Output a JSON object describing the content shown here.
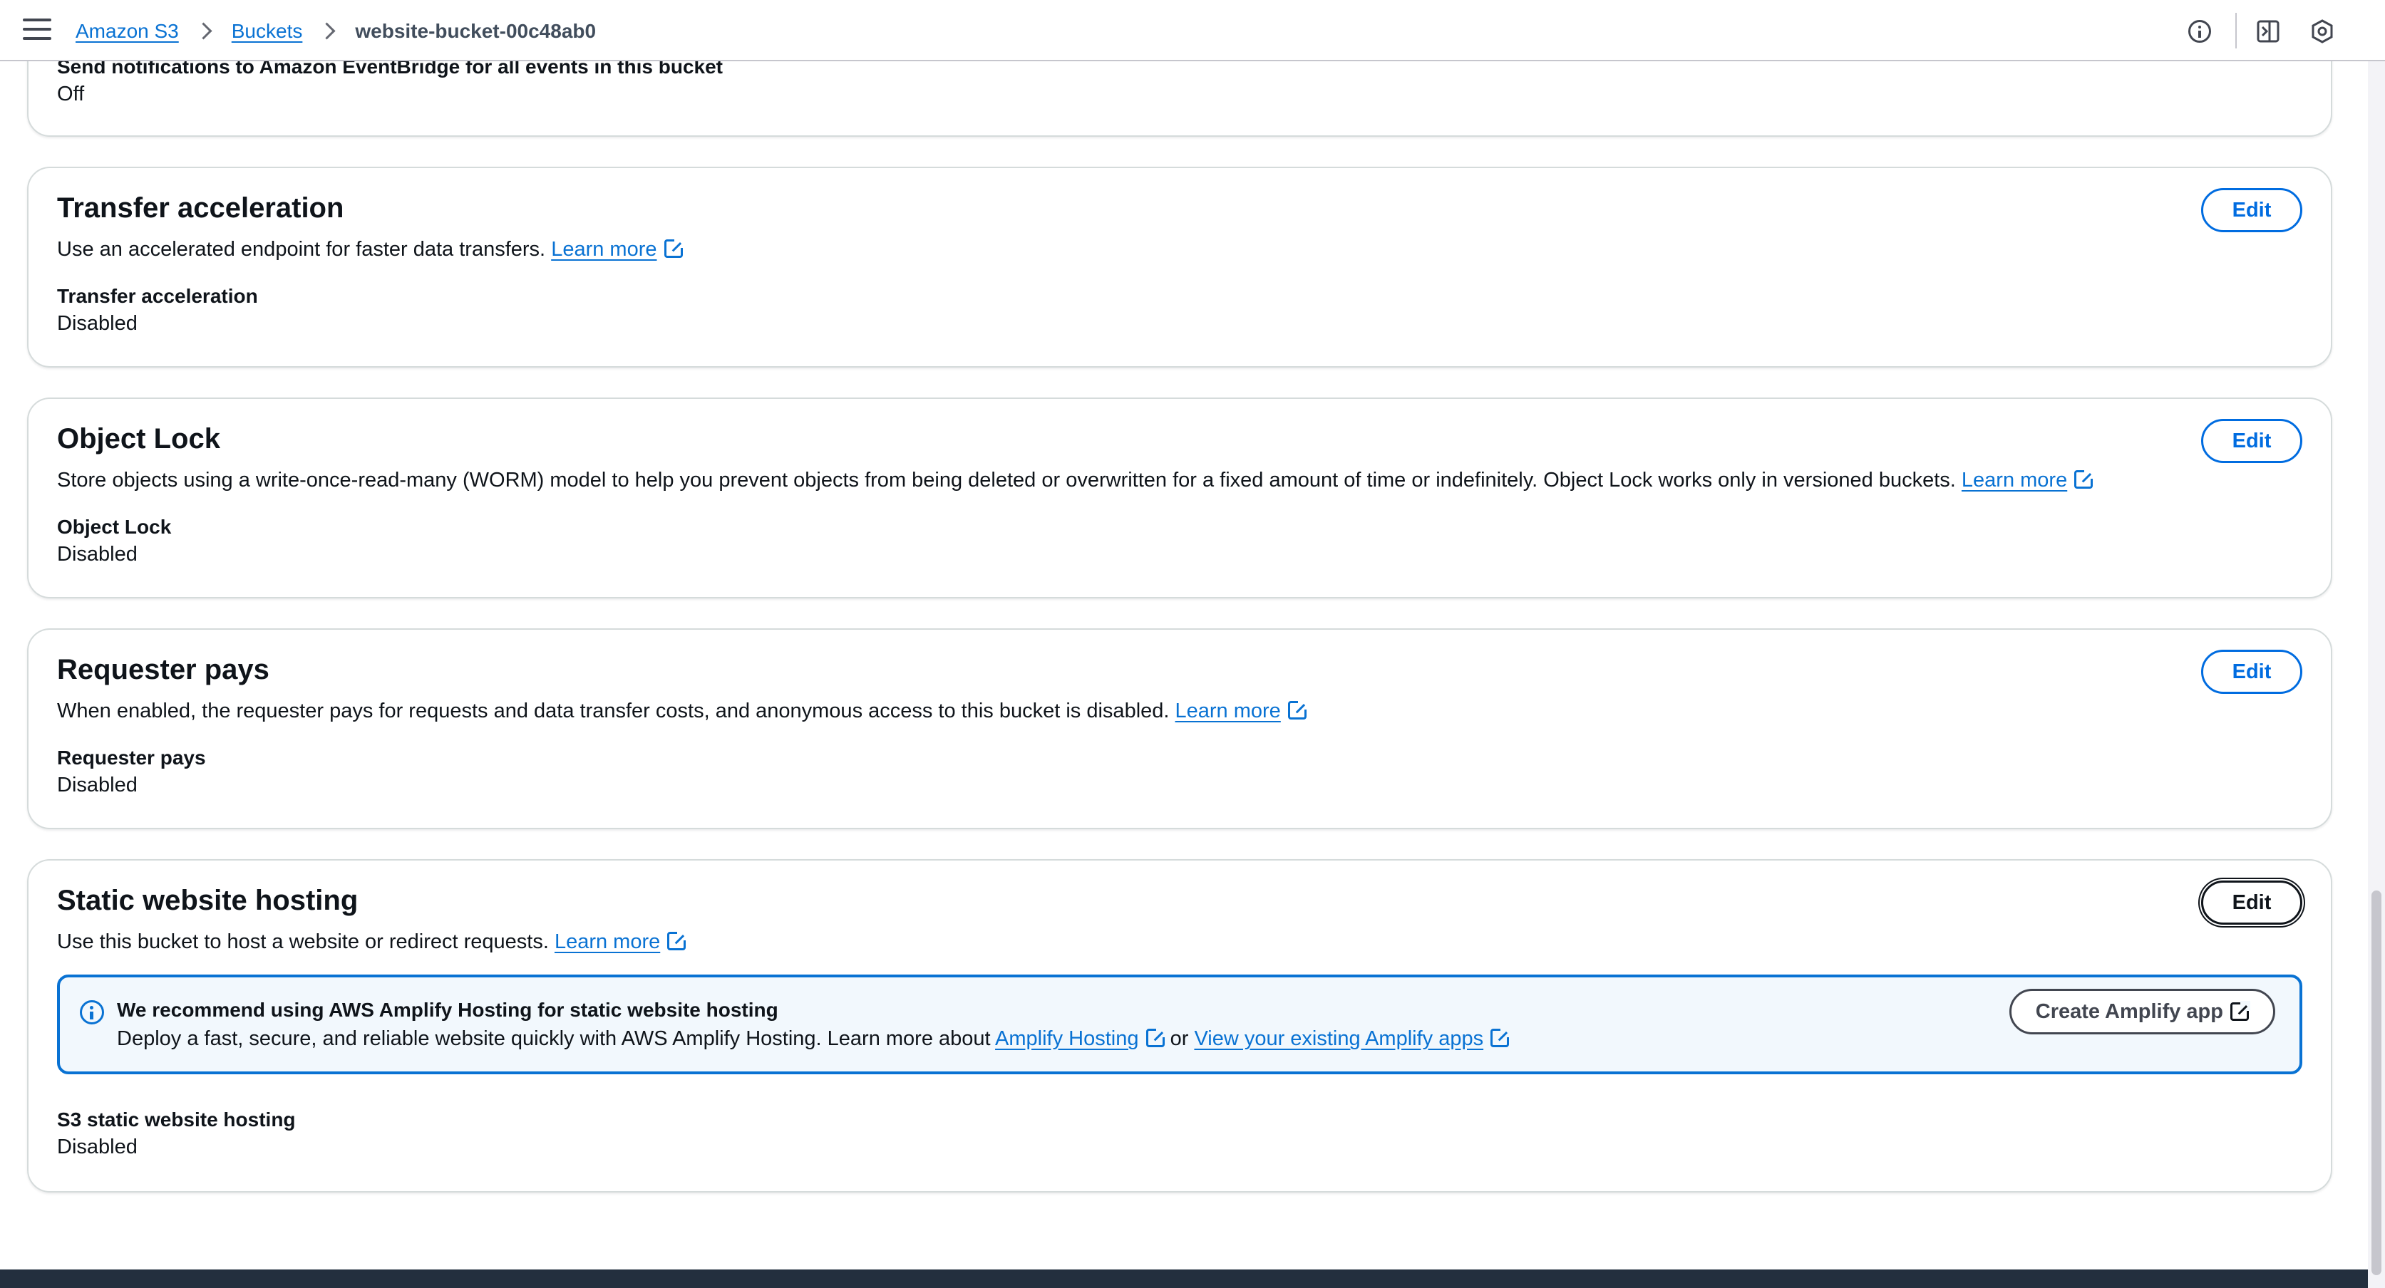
{
  "header": {
    "breadcrumbs": [
      {
        "label": "Amazon S3"
      },
      {
        "label": "Buckets"
      },
      {
        "label": "website-bucket-00c48ab0"
      }
    ],
    "icons": [
      "menu-icon",
      "info-icon",
      "notifications-icon",
      "settings-icon"
    ]
  },
  "eventbridge": {
    "label": "Send notifications to Amazon EventBridge for all events in this bucket",
    "value": "Off"
  },
  "sections": {
    "transfer_acceleration": {
      "title": "Transfer acceleration",
      "description": "Use an accelerated endpoint for faster data transfers.",
      "learn_more": "Learn more",
      "edit_label": "Edit",
      "field_label": "Transfer acceleration",
      "field_value": "Disabled"
    },
    "object_lock": {
      "title": "Object Lock",
      "description": "Store objects using a write-once-read-many (WORM) model to help you prevent objects from being deleted or overwritten for a fixed amount of time or indefinitely. Object Lock works only in versioned buckets.",
      "learn_more": "Learn more",
      "edit_label": "Edit",
      "field_label": "Object Lock",
      "field_value": "Disabled"
    },
    "requester_pays": {
      "title": "Requester pays",
      "description": "When enabled, the requester pays for requests and data transfer costs, and anonymous access to this bucket is disabled.",
      "learn_more": "Learn more",
      "edit_label": "Edit",
      "field_label": "Requester pays",
      "field_value": "Disabled"
    },
    "static_website": {
      "title": "Static website hosting",
      "description": "Use this bucket to host a website or redirect requests.",
      "learn_more": "Learn more",
      "edit_label": "Edit",
      "info": {
        "title": "We recommend using AWS Amplify Hosting for static website hosting",
        "body": "Deploy a fast, secure, and reliable website quickly with AWS Amplify Hosting. Learn more about",
        "link1": "Amplify Hosting",
        "or": "or",
        "link2": "View your existing Amplify apps",
        "button": "Create Amplify app"
      },
      "field_label": "S3 static website hosting",
      "field_value": "Disabled"
    }
  },
  "colors": {
    "link": "#0972d3",
    "text": "#0f141a",
    "info_bg": "#f2f8fd",
    "footer": "#232f3e"
  }
}
